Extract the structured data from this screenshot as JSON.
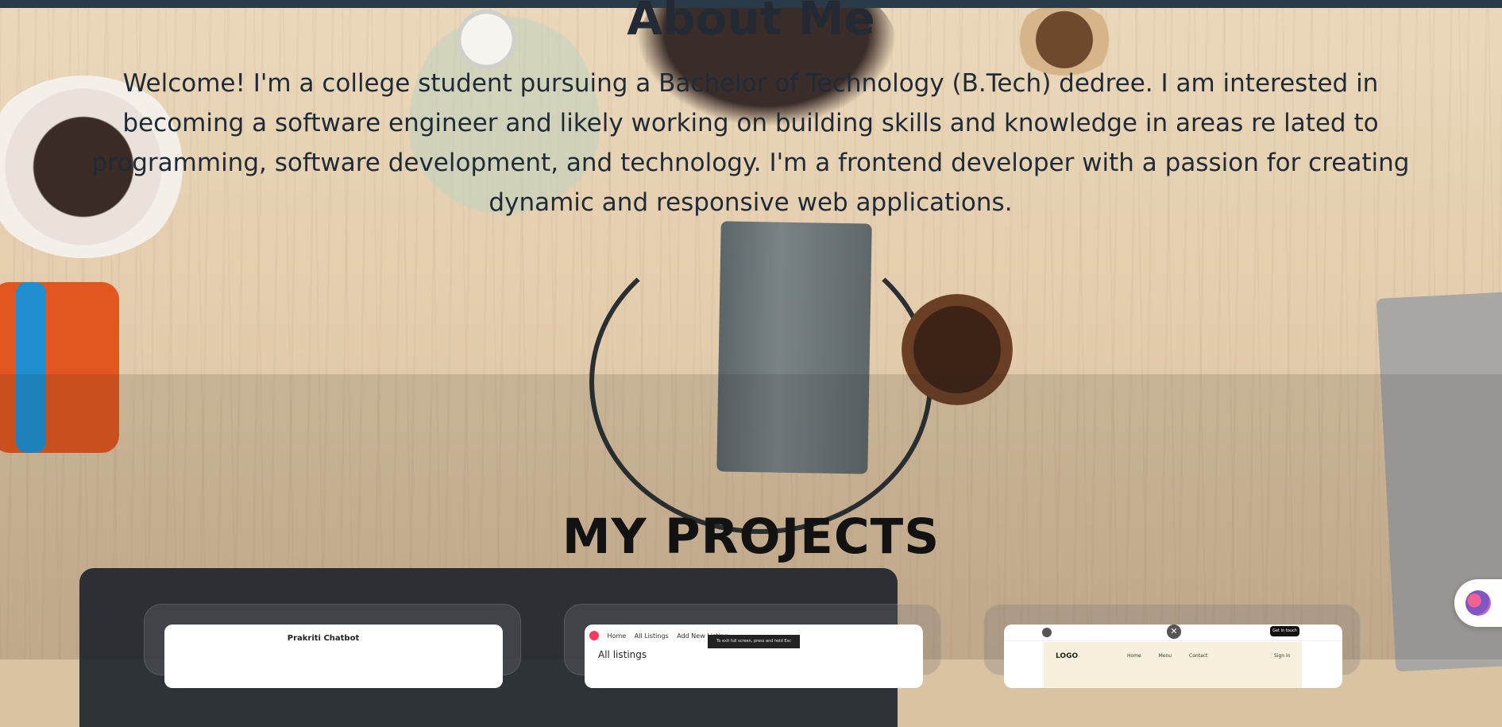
{
  "about": {
    "title": "About Me",
    "text": "Welcome! I'm a college student pursuing a Bachelor of Technology (B.Tech) dedree. I am interested in becoming a software engineer and likely working on building skills and knowledge in areas re lated to programming, software development, and technology. I'm a frontend developer with a passion for creating dynamic and responsive web applications."
  },
  "projects": {
    "title": "MY PROJECTS",
    "cards": [
      {
        "brand": "Prakriti Chatbot"
      },
      {
        "nav": [
          "Home",
          "All Listings",
          "Add New Listing"
        ],
        "toast": "To exit full screen, press and hold Esc",
        "heading": "All listings"
      },
      {
        "close": "✕",
        "cta": "Get in touch",
        "logo": "LOGO",
        "menu": [
          "Home",
          "Menu",
          "Contact"
        ],
        "signin": "Sign in"
      }
    ]
  },
  "colors": {
    "topbar": "#2b3a48",
    "heading": "#121212",
    "body_text": "#1f2a37"
  },
  "icons": {
    "chatbot": "brain-icon"
  }
}
